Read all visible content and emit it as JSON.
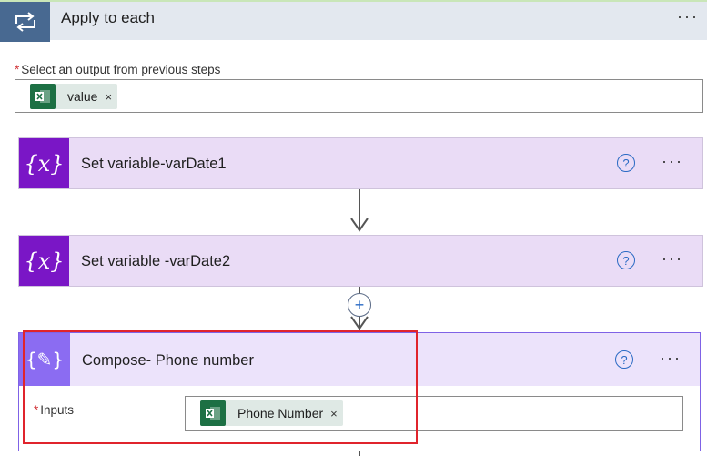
{
  "apply_to_each": {
    "title": "Apply to each",
    "more_label": "···"
  },
  "select_output": {
    "required_mark": "*",
    "label": "Select an output from previous steps",
    "token": {
      "label": "value",
      "remove": "×",
      "icon": "excel-icon"
    }
  },
  "actions": [
    {
      "title": "Set variable-varDate1",
      "icon_text": "{x}",
      "help": "?",
      "more": "···"
    },
    {
      "title": "Set variable -varDate2",
      "icon_text": "{x}",
      "help": "?",
      "more": "···"
    }
  ],
  "add_step": {
    "label": "+"
  },
  "compose": {
    "title": "Compose- Phone number",
    "icon_text": "{✎}",
    "help": "?",
    "more": "···",
    "inputs_required_mark": "*",
    "inputs_label": "Inputs",
    "token": {
      "label": "Phone Number",
      "remove": "×",
      "icon": "excel-icon"
    }
  },
  "colors": {
    "loop_accent": "#486991",
    "variable_accent": "#7a16c6",
    "compose_accent": "#8b6cf2",
    "excel_green": "#1d7044",
    "highlight_red": "#e0242c",
    "help_blue": "#2a6ac4"
  }
}
